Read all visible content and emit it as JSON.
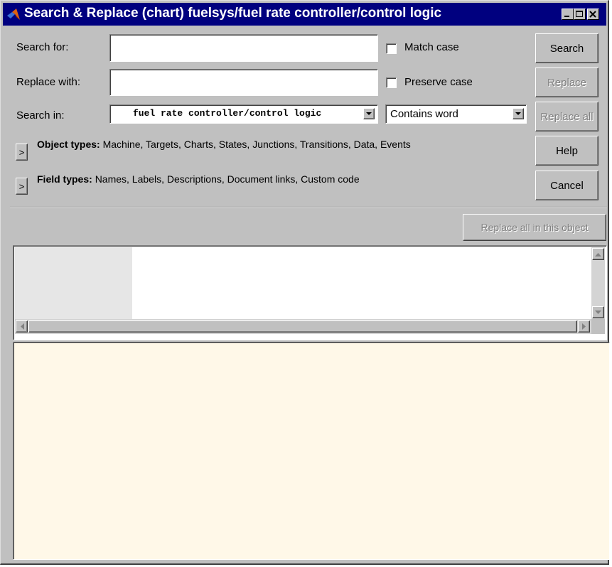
{
  "window": {
    "title": "Search & Replace (chart) fuelsys/fuel rate controller/control logic",
    "title_bg": "#00007f",
    "controls": [
      "minimize-icon",
      "maximize-icon",
      "close-icon"
    ]
  },
  "form": {
    "search_for_label": "Search for:",
    "search_for_value": "",
    "replace_with_label": "Replace with:",
    "replace_with_value": "",
    "search_in_label": "Search in:",
    "search_in_value": "fuel rate controller/control logic",
    "match_mode_value": "Contains word",
    "match_case_label": "Match case",
    "match_case_checked": false,
    "preserve_case_label": "Preserve case",
    "preserve_case_checked": false
  },
  "buttons": {
    "search": "Search",
    "replace": "Replace",
    "replace_all": "Replace all",
    "help": "Help",
    "cancel": "Cancel",
    "replace_all_in_object": "Replace all in this object"
  },
  "filters": {
    "object_types_label": "Object types:",
    "object_types_value": "Machine, Targets, Charts, States, Junctions, Transitions, Data, Events",
    "field_types_label": "Field types:",
    "field_types_value": "Names, Labels, Descriptions, Document links, Custom code",
    "expander_glyph": ">"
  },
  "colors": {
    "dialog_bg": "#c0c0c0",
    "details_bg": "#fff8e8",
    "disabled_text": "#808080"
  }
}
